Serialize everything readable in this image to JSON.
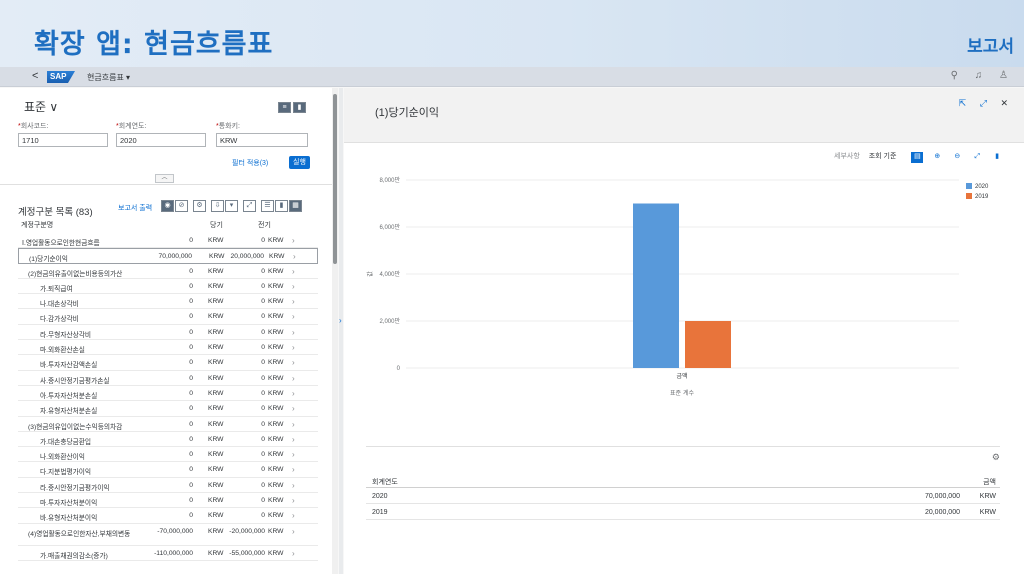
{
  "banner": {
    "title": "확장 앱: 현금흐름표",
    "right_label": "보고서"
  },
  "shell": {
    "back": "<",
    "logo": "SAP",
    "app_title": "현금흐름표 ▾",
    "icons": [
      "search-icon",
      "bell-icon",
      "user-icon"
    ]
  },
  "filter": {
    "variant": "표준 ∨",
    "fields": [
      {
        "label": "회사코드:",
        "value": "1710"
      },
      {
        "label": "회계연도:",
        "value": "2020"
      },
      {
        "label": "통화키:",
        "value": "KRW"
      }
    ],
    "adapt_filters": "필터 적용(3)",
    "go": "실행"
  },
  "table": {
    "title": "계정구분 목록 (83)",
    "report_output": "보고서 출력",
    "headers": {
      "name": "계정구분명",
      "current": "당기",
      "previous": "전기"
    },
    "rows": [
      {
        "name": "Ⅰ.영업활동으로인한현금흐름",
        "v1": "0",
        "u1": "KRW",
        "v2": "0",
        "u2": "KRW",
        "indent": 0
      },
      {
        "name": "(1)당기순이익",
        "v1": "70,000,000",
        "u1": "KRW",
        "v2": "20,000,000",
        "u2": "KRW",
        "indent": 1,
        "selected": true
      },
      {
        "name": "(2)현금의유출이없는비용등의가산",
        "v1": "0",
        "u1": "KRW",
        "v2": "0",
        "u2": "KRW",
        "indent": 1
      },
      {
        "name": "가.퇴직급여",
        "v1": "0",
        "u1": "KRW",
        "v2": "0",
        "u2": "KRW",
        "indent": 2
      },
      {
        "name": "나.대손상각비",
        "v1": "0",
        "u1": "KRW",
        "v2": "0",
        "u2": "KRW",
        "indent": 2
      },
      {
        "name": "다.감가상각비",
        "v1": "0",
        "u1": "KRW",
        "v2": "0",
        "u2": "KRW",
        "indent": 2
      },
      {
        "name": "라.무형자산상각비",
        "v1": "0",
        "u1": "KRW",
        "v2": "0",
        "u2": "KRW",
        "indent": 2
      },
      {
        "name": "마.외화환산손실",
        "v1": "0",
        "u1": "KRW",
        "v2": "0",
        "u2": "KRW",
        "indent": 2
      },
      {
        "name": "바.투자자산감액손실",
        "v1": "0",
        "u1": "KRW",
        "v2": "0",
        "u2": "KRW",
        "indent": 2
      },
      {
        "name": "사.중시안정기금평가손실",
        "v1": "0",
        "u1": "KRW",
        "v2": "0",
        "u2": "KRW",
        "indent": 2
      },
      {
        "name": "아.투자자산처분손실",
        "v1": "0",
        "u1": "KRW",
        "v2": "0",
        "u2": "KRW",
        "indent": 2
      },
      {
        "name": "자.유형자산처분손실",
        "v1": "0",
        "u1": "KRW",
        "v2": "0",
        "u2": "KRW",
        "indent": 2
      },
      {
        "name": "(3)현금의유입이없는수익등의차감",
        "v1": "0",
        "u1": "KRW",
        "v2": "0",
        "u2": "KRW",
        "indent": 1
      },
      {
        "name": "가.대손충당금환입",
        "v1": "0",
        "u1": "KRW",
        "v2": "0",
        "u2": "KRW",
        "indent": 2
      },
      {
        "name": "나.외화환산이익",
        "v1": "0",
        "u1": "KRW",
        "v2": "0",
        "u2": "KRW",
        "indent": 2
      },
      {
        "name": "다.지분법평가이익",
        "v1": "0",
        "u1": "KRW",
        "v2": "0",
        "u2": "KRW",
        "indent": 2
      },
      {
        "name": "라.중시안정기금평가이익",
        "v1": "0",
        "u1": "KRW",
        "v2": "0",
        "u2": "KRW",
        "indent": 2
      },
      {
        "name": "마.투자자산처분이익",
        "v1": "0",
        "u1": "KRW",
        "v2": "0",
        "u2": "KRW",
        "indent": 2
      },
      {
        "name": "바.유형자산처분이익",
        "v1": "0",
        "u1": "KRW",
        "v2": "0",
        "u2": "KRW",
        "indent": 2
      },
      {
        "name": "(4)영업활동으로인한자산,부채의변동",
        "v1": "-70,000,000",
        "u1": "KRW",
        "v2": "-20,000,000",
        "u2": "KRW",
        "indent": 1,
        "tall": true
      },
      {
        "name": "가.매출채권의감소(증가)",
        "v1": "-110,000,000",
        "u1": "KRW",
        "v2": "-55,000,000",
        "u2": "KRW",
        "indent": 2
      }
    ]
  },
  "detail": {
    "title": "(1)당기순이익",
    "toolbar": {
      "details": "세부사항",
      "view_by": "조회 기준"
    },
    "grid": {
      "headers": {
        "year": "회계연도",
        "amount": "금액"
      },
      "rows": [
        {
          "year": "2020",
          "amount": "70,000,000",
          "unit": "KRW"
        },
        {
          "year": "2019",
          "amount": "20,000,000",
          "unit": "KRW"
        }
      ]
    }
  },
  "chart_data": {
    "type": "bar",
    "categories": [
      "금액"
    ],
    "series": [
      {
        "name": "2020",
        "values": [
          7000
        ],
        "color": "#5899da"
      },
      {
        "name": "2019",
        "values": [
          2000
        ],
        "color": "#e8743b"
      }
    ],
    "yticks": [
      "0",
      "2,000만",
      "4,000만",
      "6,000만",
      "8,000만"
    ],
    "ylim": [
      0,
      8000
    ],
    "ylabel": "값",
    "xlabel": "표준 계수",
    "legend": "top-right",
    "grid": true
  }
}
